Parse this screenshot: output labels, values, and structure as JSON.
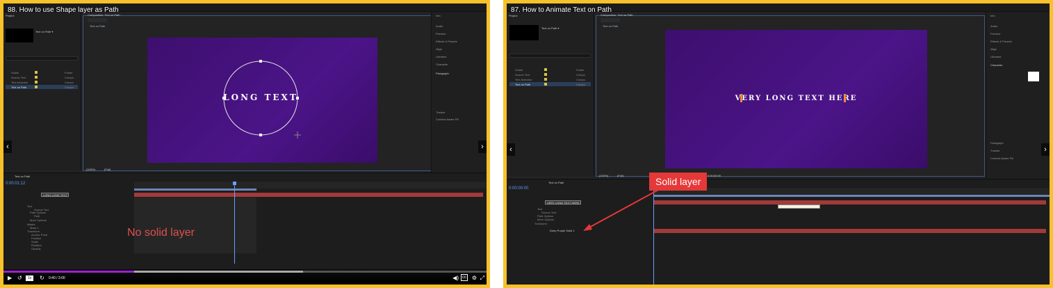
{
  "left": {
    "title": "88. How to use Shape layer as Path",
    "project_tab": "Project",
    "selected_item": "Text on Path ▾",
    "comp_tab": "Composition: Text on Path",
    "viewer_tab": "Text on Path",
    "project_items": [
      "Solids",
      "Source Text",
      "Text Animator",
      "Text on Path"
    ],
    "project_types": [
      "Folder",
      "Compo",
      "Compo",
      "Compo"
    ],
    "right_panel_items": [
      "Info",
      "Audio",
      "Preview",
      "Effects & Presets",
      "Align",
      "Libraries",
      "Character",
      "Paragraph",
      "Tracker",
      "Content-Aware Fill"
    ],
    "comp_text": "LONG TEXT",
    "zoom": "(100%)",
    "resolution": "(Full)",
    "timecode": "0:00:01:12",
    "timeline_tab": "Text on Path",
    "layer_name": "LONG LONG TEXT",
    "properties": [
      "Text",
      "Source Text",
      "Path Options",
      "Path",
      "More Options",
      "Masks",
      "Mask 1",
      "Transform",
      "Anchor Point",
      "Position",
      "Scale",
      "Rotation",
      "Opacity"
    ],
    "annotation": "No solid layer",
    "player_time": "0:40 / 3:00",
    "colors": {
      "border": "#f6c12b",
      "comp": "#4b1488",
      "annotation": "#e05050",
      "progress": "#9a1fd6",
      "track": "#a33a3a"
    },
    "progress_fraction": 0.27,
    "buffer_fraction": 0.62
  },
  "right": {
    "title": "87. How to Animate Text on Path",
    "project_tab": "Project",
    "selected_item": "Text on Path ▾",
    "comp_tab": "Composition: Text on Path",
    "viewer_tab": "Text on Path",
    "project_items": [
      "Solids",
      "Source Text",
      "Text Animator",
      "Text on Path"
    ],
    "project_types": [
      "Folder",
      "Compo",
      "Compo",
      "Compo"
    ],
    "right_panel_items": [
      "Info",
      "Audio",
      "Preview",
      "Effects & Presets",
      "Align",
      "Libraries",
      "Character",
      "Paragraph",
      "Tracker",
      "Content-Aware Fill"
    ],
    "comp_text": "VERY LONG TEXT HERE",
    "zoom": "(100%)",
    "resolution": "(Full)",
    "timecode": "0:00:00:00",
    "timeline_tab": "Text on Path",
    "layer_1": "VERY LONG TEXT HERE",
    "layer_2": "Deep Purple Solid 1",
    "properties": [
      "Text",
      "Source Text",
      "Path Options",
      "More Options",
      "Transform"
    ],
    "tooltip": "Time Ruler (Click to set thumb)",
    "callout": "Solid layer",
    "colors": {
      "border": "#f6c12b",
      "comp": "#4b1488",
      "callout": "#e53838",
      "track": "#a33a3a"
    }
  }
}
